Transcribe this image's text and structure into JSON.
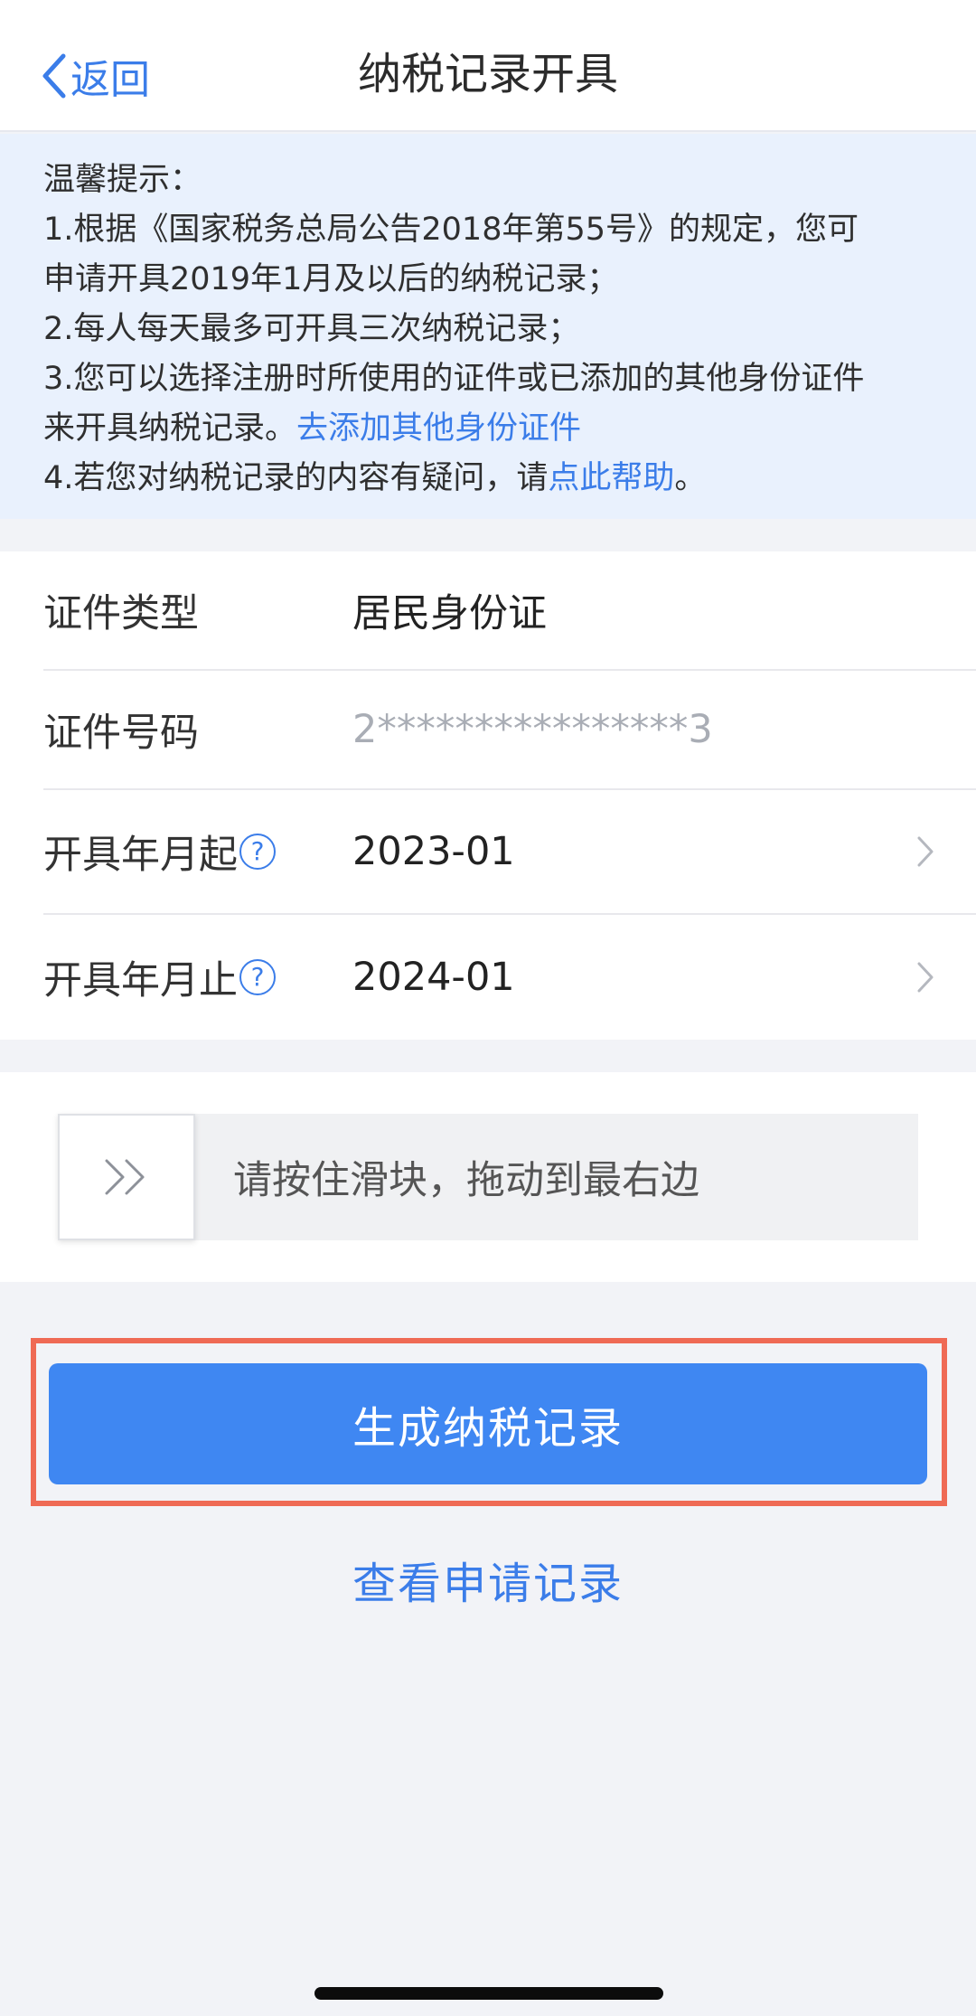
{
  "nav": {
    "back_label": "返回",
    "title": "纳税记录开具"
  },
  "notice": {
    "heading": "温馨提示：",
    "line1": "1.根据《国家税务总局公告2018年第55号》的规定，您可",
    "line2": "申请开具2019年1月及以后的纳税记录；",
    "line3": "2.每人每天最多可开具三次纳税记录；",
    "line4": "3.您可以选择注册时所使用的证件或已添加的其他身份证件",
    "line5_prefix": "来开具纳税记录。",
    "line5_link": "去添加其他身份证件",
    "line6_prefix": "4.若您对纳税记录的内容有疑问，请",
    "line6_link": "点此帮助",
    "line6_suffix": "。"
  },
  "form": {
    "id_type_label": "证件类型",
    "id_type_value": "居民身份证",
    "id_number_label": "证件号码",
    "id_number_value": "2****************3",
    "start_label": "开具年月起",
    "start_value": "2023-01",
    "end_label": "开具年月止",
    "end_value": "2024-01",
    "help_glyph": "?"
  },
  "slider": {
    "text": "请按住滑块，拖动到最右边",
    "progress": 0
  },
  "actions": {
    "generate_label": "生成纳税记录",
    "view_records_label": "查看申请记录"
  },
  "colors": {
    "accent": "#3b7de9",
    "button": "#3f87f2",
    "highlight_outline": "#ef6a55",
    "notice_bg": "#e9f1fd"
  },
  "icons": {
    "back": "chevron-left-icon",
    "help": "question-circle-icon",
    "row_arrow": "chevron-right-icon",
    "slider": "double-chevron-right-icon"
  }
}
